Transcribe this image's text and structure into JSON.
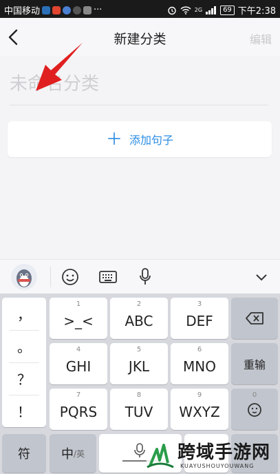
{
  "status_bar": {
    "carrier": "中国移动",
    "more": "···",
    "battery": "69",
    "time": "下午2:38",
    "network": "2G",
    "app_icon_colors": [
      "#2b6fb8",
      "#e0452f",
      "#4a7fd0",
      "#555555",
      "#888888"
    ]
  },
  "nav": {
    "title": "新建分类",
    "edit_label": "编辑"
  },
  "category_name": {
    "placeholder": "未命名分类",
    "value": ""
  },
  "add_sentence": {
    "plus": "＋",
    "label": "添加句子"
  },
  "colors": {
    "accent": "#2b8de3",
    "arrow": "#e02020"
  },
  "keyboard": {
    "punctuation": [
      "，",
      "。",
      "？",
      "！"
    ],
    "keys": [
      {
        "num": "1",
        "letters": ">_<"
      },
      {
        "num": "2",
        "letters": "ABC"
      },
      {
        "num": "3",
        "letters": "DEF"
      },
      {
        "num": "4",
        "letters": "GHI"
      },
      {
        "num": "5",
        "letters": "JKL"
      },
      {
        "num": "6",
        "letters": "MNO"
      },
      {
        "num": "7",
        "letters": "PQRS"
      },
      {
        "num": "8",
        "letters": "TUV"
      },
      {
        "num": "9",
        "letters": "WXYZ"
      }
    ],
    "reenter_label": "重输",
    "zero_label": "0",
    "symbol_label": "符",
    "lang_main": "中",
    "lang_alt": "/英"
  },
  "watermark": {
    "text": "跨域手游网",
    "sub": "KUAYUSHOUYOUWANG"
  }
}
